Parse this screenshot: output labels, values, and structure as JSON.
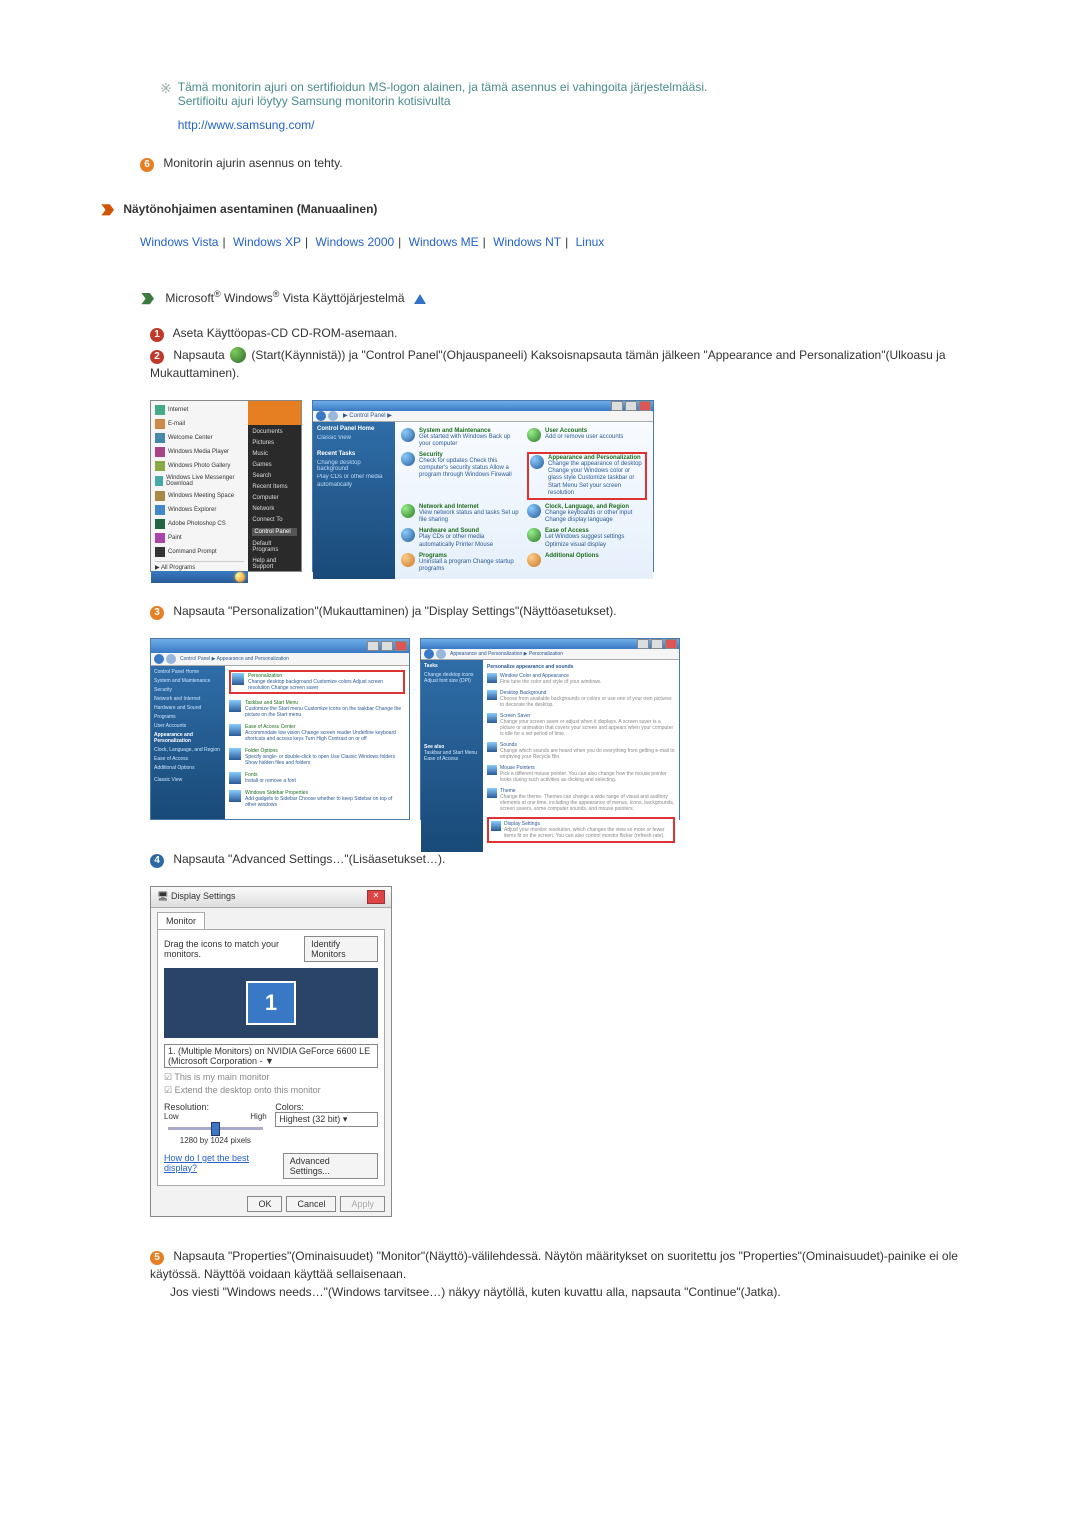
{
  "intro": {
    "line1": "Tämä monitorin ajuri on sertifioidun MS-logon alainen, ja tämä asennus ei vahingoita järjestelmääsi.",
    "line2": "Sertifioitu ajuri löytyy Samsung monitorin kotisivulta",
    "url": "http://www.samsung.com/"
  },
  "step_done": {
    "num": "6",
    "text": "Monitorin ajurin asennus on tehty."
  },
  "manual_header": "Näytönohjaimen asentaminen (Manuaalinen)",
  "os_links": {
    "vista": "Windows Vista",
    "xp": "Windows XP",
    "w2000": "Windows 2000",
    "me": "Windows ME",
    "nt": "Windows NT",
    "linux": "Linux"
  },
  "vista_heading_pre": "Microsoft",
  "vista_heading_mid": "Windows",
  "vista_heading_post": "Vista Käyttöjärjestelmä",
  "step1": {
    "num": "1",
    "text": "Aseta Käyttöopas-CD CD-ROM-asemaan."
  },
  "step2": {
    "num": "2",
    "text_a": "Napsauta",
    "text_b": "(Start(Käynnistä)) ja \"Control Panel\"(Ohjauspaneeli) Kaksoisnapsauta tämän jälkeen \"Appearance and Personalization\"(Ulkoasu ja Mukauttaminen)."
  },
  "start_menu": {
    "items": [
      "Internet",
      "E-mail",
      "Welcome Center",
      "Windows Media Player",
      "Windows Photo Gallery",
      "Windows Live Messenger Download",
      "Windows Meeting Space",
      "Windows Explorer",
      "Adobe Photoshop CS",
      "Paint",
      "Command Prompt"
    ],
    "all_programs": "All Programs",
    "right": [
      "Documents",
      "Pictures",
      "Music",
      "Games",
      "Search",
      "Recent Items",
      "Computer",
      "Network",
      "Connect To",
      "Control Panel",
      "Default Programs",
      "Help and Support"
    ]
  },
  "control_panel": {
    "addr": "Control Panel",
    "left_hdr": "Control Panel Home",
    "left_sub": "Classic View",
    "recent": "Recent Tasks",
    "items_left": [
      {
        "t": "System and Maintenance",
        "d": "Get started with Windows\nBack up your computer"
      },
      {
        "t": "Security",
        "d": "Check for updates\nCheck this computer's security status\nAllow a program through Windows Firewall"
      },
      {
        "t": "Network and Internet",
        "d": "View network status and tasks\nSet up file sharing"
      },
      {
        "t": "Hardware and Sound",
        "d": "Play CDs or other media automatically\nPrinter\nMouse"
      },
      {
        "t": "Programs",
        "d": "Uninstall a program\nChange startup programs"
      }
    ],
    "items_right": [
      {
        "t": "User Accounts",
        "d": "Add or remove user accounts"
      },
      {
        "t": "Appearance and Personalization",
        "d": "Change the appearance of desktop\nChange your Windows color or glass style\nCustomize taskbar or Start Menu\nSet your screen resolution"
      },
      {
        "t": "Clock, Language, and Region",
        "d": "Change keyboards or other input\nChange display language"
      },
      {
        "t": "Ease of Access",
        "d": "Let Windows suggest settings\nOptimize visual display"
      },
      {
        "t": "Additional Options",
        "d": ""
      }
    ]
  },
  "step3": {
    "num": "3",
    "text": "Napsauta \"Personalization\"(Mukauttaminen) ja \"Display Settings\"(Näyttöasetukset)."
  },
  "perso_left": {
    "addr": "Control Panel ▶ Appearance and Personalization",
    "side": [
      "Control Panel Home",
      "System and Maintenance",
      "Security",
      "Network and Internet",
      "Hardware and Sound",
      "Programs",
      "User Accounts",
      "Appearance and Personalization",
      "Clock, Language, and Region",
      "Ease of Access",
      "Additional Options",
      "Classic View"
    ],
    "items": [
      {
        "t": "Personalization",
        "d": "Change desktop background  Customize colors  Adjust screen resolution  Change screen saver"
      },
      {
        "t": "Taskbar and Start Menu",
        "d": "Customize the Start menu  Customize icons on the taskbar  Change the picture on the Start menu"
      },
      {
        "t": "Ease of Access Center",
        "d": "Accommodate low vision  Change screen reader  Underline keyboard shortcuts and access keys  Turn High Contrast on or off"
      },
      {
        "t": "Folder Options",
        "d": "Specify single- or double-click to open  Use Classic Windows folders  Show hidden files and folders"
      },
      {
        "t": "Fonts",
        "d": "Install or remove a font"
      },
      {
        "t": "Windows Sidebar Properties",
        "d": "Add gadgets to Sidebar  Choose whether to keep Sidebar on top of other windows"
      }
    ]
  },
  "perso_right": {
    "addr": "Appearance and Personalization ▶ Personalization",
    "side": [
      "Tasks",
      "Change desktop icons",
      "Adjust font size (DPI)"
    ],
    "heading": "Personalize appearance and sounds",
    "sub1": "Window Color and Appearance",
    "sub1d": "Fine tune the color and style of your windows.",
    "items": [
      {
        "t": "Desktop Background",
        "d": "Choose from available backgrounds or colors or use one of your own pictures to decorate the desktop."
      },
      {
        "t": "Screen Saver",
        "d": "Change your screen saver or adjust when it displays. A screen saver is a picture or animation that covers your screen and appears when your computer is idle for a set period of time."
      },
      {
        "t": "Sounds",
        "d": "Change which sounds are heard when you do everything from getting e-mail to emptying your Recycle Bin."
      },
      {
        "t": "Mouse Pointers",
        "d": "Pick a different mouse pointer. You can also change how the mouse pointer looks during such activities as clicking and selecting."
      },
      {
        "t": "Theme",
        "d": "Change the theme. Themes can change a wide range of visual and auditory elements at one time, including the appearance of menus, icons, backgrounds, screen savers, some computer sounds, and mouse pointers."
      },
      {
        "t": "Display Settings",
        "d": "Adjust your monitor resolution, which changes the view so more or fewer items fit on the screen. You can also control monitor flicker (refresh rate)."
      }
    ],
    "seealso": "See also",
    "seealso_items": [
      "Taskbar and Start Menu",
      "Ease of Access"
    ]
  },
  "step4": {
    "num": "4",
    "text": "Napsauta \"Advanced Settings…\"(Lisäasetukset…)."
  },
  "display_dialog": {
    "title": "Display Settings",
    "tab": "Monitor",
    "drag_text": "Drag the icons to match your monitors.",
    "identify": "Identify Monitors",
    "mon_num": "1",
    "dropdown": "1. (Multiple Monitors) on NVIDIA GeForce 6600 LE (Microsoft Corporation - ▼",
    "chk1": "This is my main monitor",
    "chk2": "Extend the desktop onto this monitor",
    "res_label": "Resolution:",
    "low": "Low",
    "high": "High",
    "res_val": "1280 by 1024 pixels",
    "colors_label": "Colors:",
    "colors_val": "Highest (32 bit)",
    "help_link": "How do I get the best display?",
    "adv": "Advanced Settings...",
    "ok": "OK",
    "cancel": "Cancel",
    "apply": "Apply"
  },
  "step5": {
    "num": "5",
    "text_a": "Napsauta \"Properties\"(Ominaisuudet) \"Monitor\"(Näyttö)-välilehdessä. Näytön määritykset on suoritettu jos \"Properties\"(Ominaisuudet)-painike ei ole käytössä. Näyttöä voidaan käyttää sellaisenaan.",
    "text_b": "Jos viesti \"Windows needs…\"(Windows tarvitsee…) näkyy näytöllä, kuten kuvattu alla, napsauta \"Continue\"(Jatka)."
  }
}
